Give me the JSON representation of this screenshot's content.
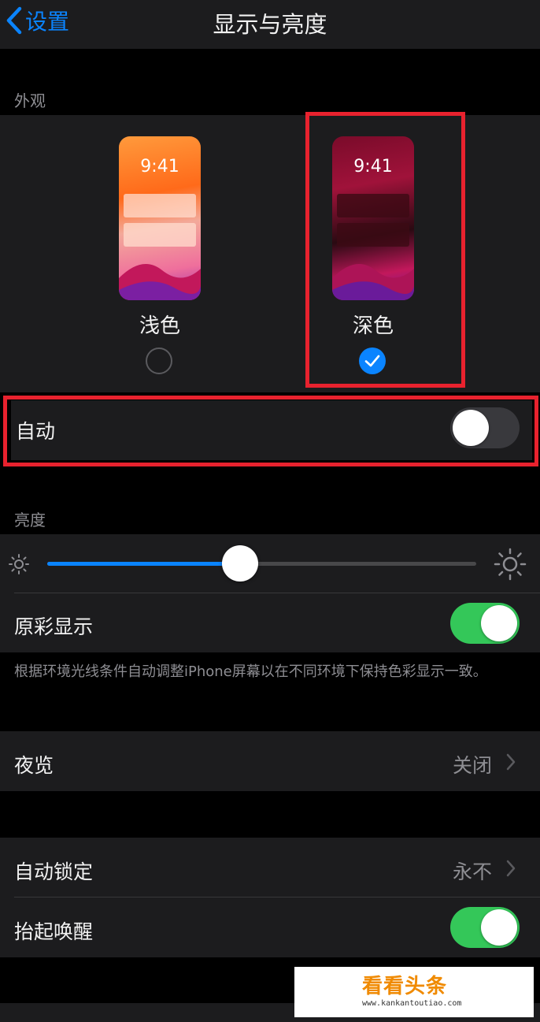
{
  "nav": {
    "back_label": "设置",
    "title": "显示与亮度"
  },
  "appearance": {
    "section_label": "外观",
    "light": {
      "label": "浅色",
      "time": "9:41",
      "selected": false
    },
    "dark": {
      "label": "深色",
      "time": "9:41",
      "selected": true
    },
    "auto": {
      "label": "自动",
      "on": false
    }
  },
  "brightness": {
    "section_label": "亮度",
    "level_percent": 45,
    "true_tone": {
      "label": "原彩显示",
      "on": true
    },
    "footer": "根据环境光线条件自动调整iPhone屏幕以在不同环境下保持色彩显示一致。"
  },
  "night_shift": {
    "label": "夜览",
    "value": "关闭"
  },
  "auto_lock": {
    "label": "自动锁定",
    "value": "永不"
  },
  "raise_to_wake": {
    "label": "抬起唤醒",
    "on": true
  },
  "watermark": {
    "text": "看看头条",
    "url": "www.kankantoutiao.com"
  },
  "colors": {
    "accent": "#0a84ff",
    "toggle_on": "#34c759",
    "highlight": "#e8222e"
  }
}
